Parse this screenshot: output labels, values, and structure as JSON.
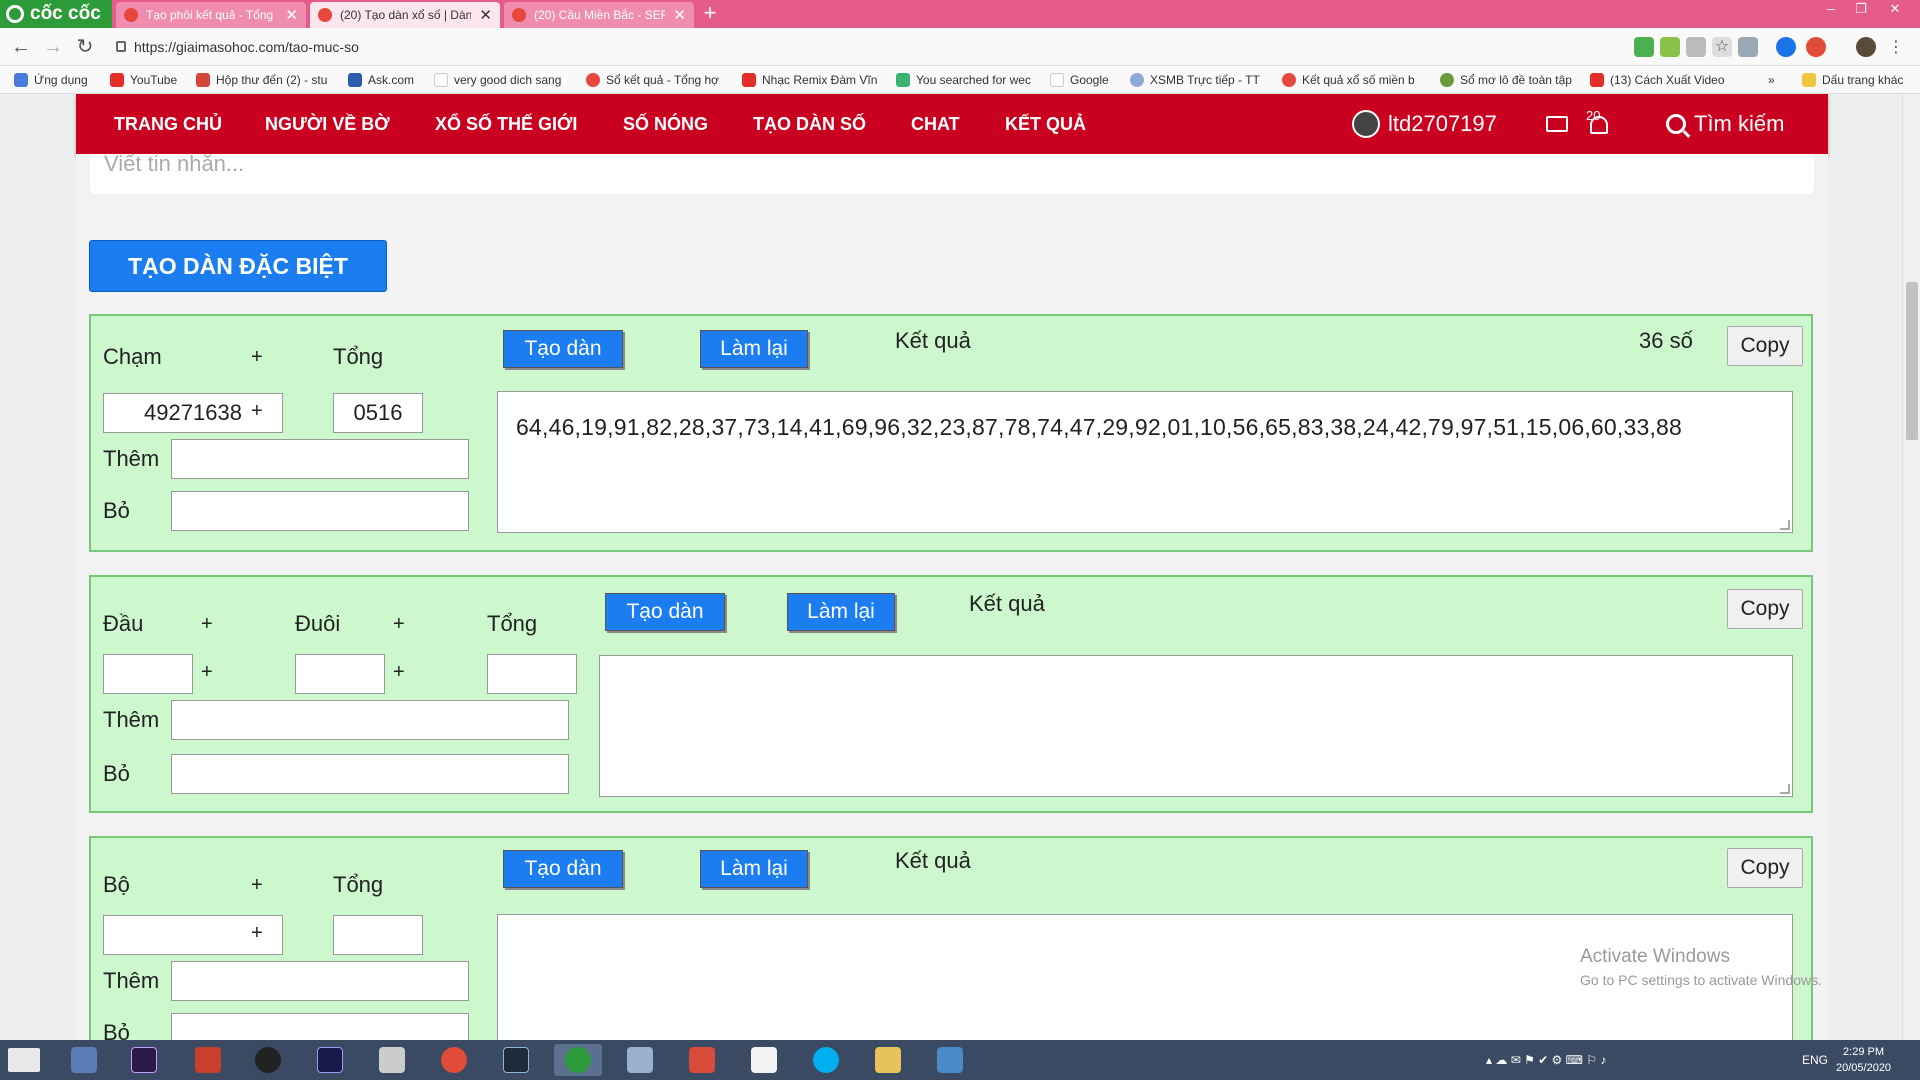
{
  "browser": {
    "brand": "cốc cốc",
    "tabs": [
      {
        "title": "Tạo phôi kết quả - Tổng",
        "active": false
      },
      {
        "title": "(20) Tạo dàn xổ số | Dàn",
        "active": true
      },
      {
        "title": "(20) Cầu Miền Bắc - SERI",
        "active": false
      }
    ],
    "url": "https://giaimasohoc.com/tao-muc-so",
    "bookmarks": [
      "Ứng dụng",
      "YouTube",
      "Hộp thư đến (2) - stu",
      "Ask.com",
      "very good dich sang",
      "Sổ kết quả - Tổng hợ",
      "Nhạc Remix Đàm Vĩn",
      "You searched for wec",
      "Google",
      "XSMB Trực tiếp - TT",
      "Kết quả xổ số miền b",
      "Sổ mơ lô đề toàn tập",
      "(13) Cách Xuất Video"
    ],
    "bookmarks_more": "»",
    "other_bookmarks": "Dấu trang khác"
  },
  "nav": {
    "items": [
      "TRANG CHỦ",
      "NGƯỜI VỀ BỜ",
      "XỔ SỐ THẾ GIỚI",
      "SỐ NÓNG",
      "TẠO DÀN SỐ",
      "CHAT",
      "KẾT QUẢ"
    ],
    "username": "ltd2707197",
    "notification_count": "20",
    "search_label": "Tìm kiếm"
  },
  "message_placeholder": "Viết tin nhắn...",
  "special_button": "TẠO DÀN ĐẶC BIỆT",
  "panel1": {
    "label_cham": "Chạm",
    "plus": "+",
    "label_tong": "Tổng",
    "cham_value": "49271638",
    "tong_value": "0516",
    "label_them": "Thêm",
    "label_bo": "Bỏ",
    "btn_tao": "Tạo dàn",
    "btn_lam": "Làm lại",
    "ketqua": "Kết quả",
    "count": "36 số",
    "copy": "Copy",
    "result": "64,46,19,91,82,28,37,73,14,41,69,96,32,23,87,78,74,47,29,92,01,10,56,65,83,38,24,42,79,97,51,15,06,60,33,88"
  },
  "panel2": {
    "label_dau": "Đầu",
    "label_duoi": "Đuôi",
    "label_tong": "Tổng",
    "plus": "+",
    "label_them": "Thêm",
    "label_bo": "Bỏ",
    "btn_tao": "Tạo dàn",
    "btn_lam": "Làm lại",
    "ketqua": "Kết quả",
    "copy": "Copy"
  },
  "panel3": {
    "label_bo_set": "Bộ",
    "label_tong": "Tổng",
    "plus": "+",
    "label_them": "Thêm",
    "label_bo": "Bỏ",
    "btn_tao": "Tạo dàn",
    "btn_lam": "Làm lại",
    "ketqua": "Kết quả",
    "copy": "Copy"
  },
  "watermark": {
    "line1": "Activate Windows",
    "line2": "Go to PC settings to activate Windows."
  },
  "taskbar": {
    "lang": "ENG",
    "time": "2:29 PM",
    "date": "20/05/2020"
  },
  "colors": {
    "nav_red": "#c9001f",
    "panel_green": "#cdf7cd",
    "button_blue": "#1b7df0",
    "tab_pink": "#e55c8a"
  }
}
